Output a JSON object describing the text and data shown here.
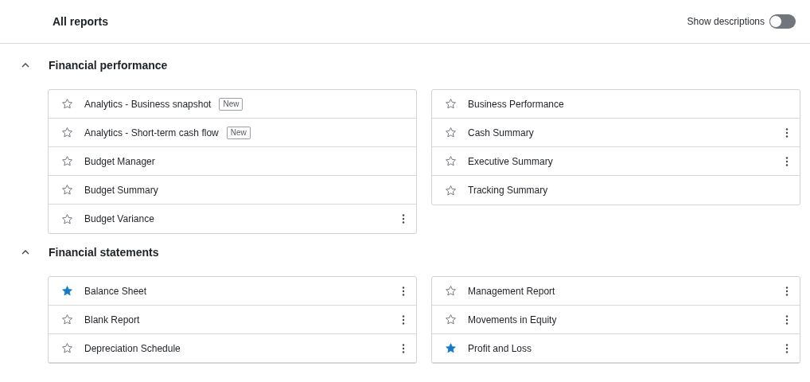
{
  "header": {
    "title": "All reports",
    "toggle": {
      "label": "Show descriptions",
      "on": false
    }
  },
  "sections": [
    {
      "title": "Financial performance",
      "expanded": true,
      "columns": [
        [
          {
            "name": "Analytics - Business snapshot",
            "starred": false,
            "badge": "New",
            "menu": false
          },
          {
            "name": "Analytics - Short-term cash flow",
            "starred": false,
            "badge": "New",
            "menu": false
          },
          {
            "name": "Budget Manager",
            "starred": false,
            "menu": false
          },
          {
            "name": "Budget Summary",
            "starred": false,
            "menu": false
          },
          {
            "name": "Budget Variance",
            "starred": false,
            "menu": true
          }
        ],
        [
          {
            "name": "Business Performance",
            "starred": false,
            "menu": false
          },
          {
            "name": "Cash Summary",
            "starred": false,
            "menu": true
          },
          {
            "name": "Executive Summary",
            "starred": false,
            "menu": true
          },
          {
            "name": "Tracking Summary",
            "starred": false,
            "menu": false
          }
        ]
      ]
    },
    {
      "title": "Financial statements",
      "expanded": true,
      "columns": [
        [
          {
            "name": "Balance Sheet",
            "starred": true,
            "menu": true
          },
          {
            "name": "Blank Report",
            "starred": false,
            "menu": true
          },
          {
            "name": "Depreciation Schedule",
            "starred": false,
            "menu": true
          }
        ],
        [
          {
            "name": "Management Report",
            "starred": false,
            "menu": true
          },
          {
            "name": "Movements in Equity",
            "starred": false,
            "menu": true
          },
          {
            "name": "Profit and Loss",
            "starred": true,
            "menu": true
          }
        ]
      ]
    }
  ]
}
